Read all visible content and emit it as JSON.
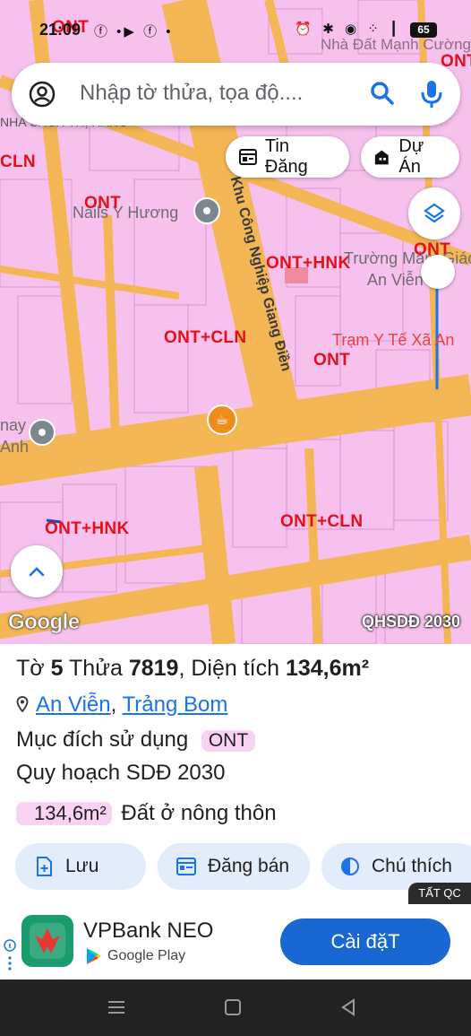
{
  "status_bar": {
    "time": "21:09",
    "battery": "65",
    "left_icons": "ⓕ •▶ ⓕ •",
    "right_icons": "⏰ ✱ ◉ ⁘ ┃"
  },
  "watermark": "Nhà Đất Mạnh Cường",
  "search": {
    "placeholder": "Nhập tờ thửa, tọa độ...."
  },
  "chips": {
    "listings": "Tin Đăng",
    "projects": "Dự Án"
  },
  "map_labels": {
    "zones": [
      "CLN",
      "ONT",
      "ONT+HNK",
      "ONT+CLN",
      "ONT",
      "ONT+HNK",
      "ONT+CLN",
      "ONT",
      "ONT",
      "ONT"
    ],
    "nails": "Nails Y Hương",
    "school": "Trường Mầm Giáo",
    "school2": "An Viễn Cs",
    "clinic": "Trạm Y Tế Xã An",
    "street": "Khu Công Nghiệp Giang Điền",
    "nay": "nay",
    "anh": "Anh",
    "top_left": "NHÀ SÁCH THỊ HẰNG"
  },
  "map_footer": {
    "google": "Google",
    "plan": "QHSDĐ 2030"
  },
  "parcel": {
    "sheet_label": "Tờ",
    "sheet": "5",
    "plot_label": "Thửa",
    "plot": "7819",
    "area_label": ", Diện tích",
    "area": "134,6m²",
    "commune": "An Viễn",
    "district": "Trảng Bom",
    "sep": ",",
    "purpose_label": "Mục đích sử dụng",
    "purpose": "ONT",
    "plan_label": "Quy hoạch SDĐ 2030",
    "plan_area": "134,6m²",
    "plan_use": "Đất ở nông thôn"
  },
  "actions": {
    "save": "Lưu",
    "post": "Đăng bán",
    "legend": "Chú thích"
  },
  "ad": {
    "close": "TẤT QC",
    "app": "VPBank NEO",
    "store": "Google Play",
    "install": "Cài đặT"
  },
  "colors": {
    "map_bg": "#f7c1ee",
    "road": "#f4b654",
    "accent": "#1a73e8",
    "install": "#1967d2",
    "zone_text": "#e3101a"
  }
}
